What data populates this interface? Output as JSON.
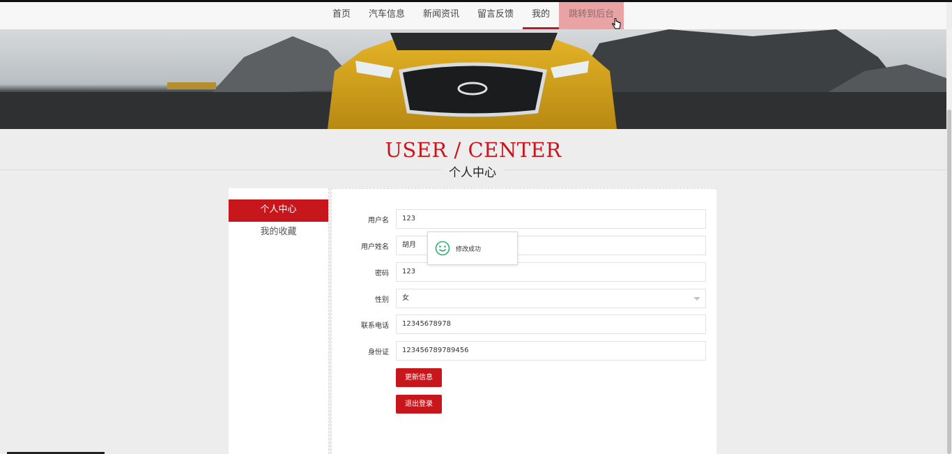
{
  "nav": {
    "items": [
      {
        "label": "首页"
      },
      {
        "label": "汽车信息"
      },
      {
        "label": "新闻资讯"
      },
      {
        "label": "留言反馈"
      },
      {
        "label": "我的"
      },
      {
        "label": "跳转到后台"
      }
    ],
    "active_index": 4,
    "highlight_index": 5
  },
  "banner": {
    "image": "infiniti-yellow-car-front"
  },
  "section": {
    "title_en": "USER / CENTER",
    "title_cn": "个人中心"
  },
  "sidebar": {
    "items": [
      {
        "label": "个人中心"
      },
      {
        "label": "我的收藏"
      }
    ]
  },
  "form": {
    "username": {
      "label": "用户名",
      "value": "123"
    },
    "name": {
      "label": "用户姓名",
      "value": "胡月"
    },
    "password": {
      "label": "密码",
      "value": "123"
    },
    "gender": {
      "label": "性别",
      "value": "女"
    },
    "phone": {
      "label": "联系电话",
      "value": "12345678978"
    },
    "id_card": {
      "label": "身份证",
      "value": "123456789789456"
    },
    "update_button": "更新信息",
    "logout_button": "退出登录"
  },
  "toast": {
    "message": "修改成功",
    "icon": "smile-icon"
  },
  "colors": {
    "accent": "#c8161d",
    "admin_button": "#e9a3a5",
    "success_icon": "#2db16a"
  }
}
